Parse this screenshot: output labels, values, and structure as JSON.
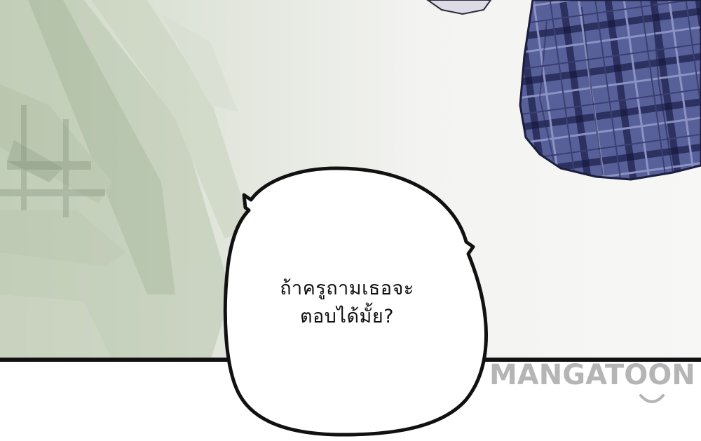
{
  "speech_bubble": {
    "line_1": "ถ้าครูถามเธอจะ",
    "line_2": "ตอบได้มั้ย?"
  },
  "watermark": {
    "text": "MANGATOON",
    "color": "#b5b5b5"
  },
  "colors": {
    "panel_border": "#111111",
    "plaid_base": "#4e5688",
    "plaid_dark": "#2a2f55",
    "background_greenery": "#c9d4c0"
  }
}
